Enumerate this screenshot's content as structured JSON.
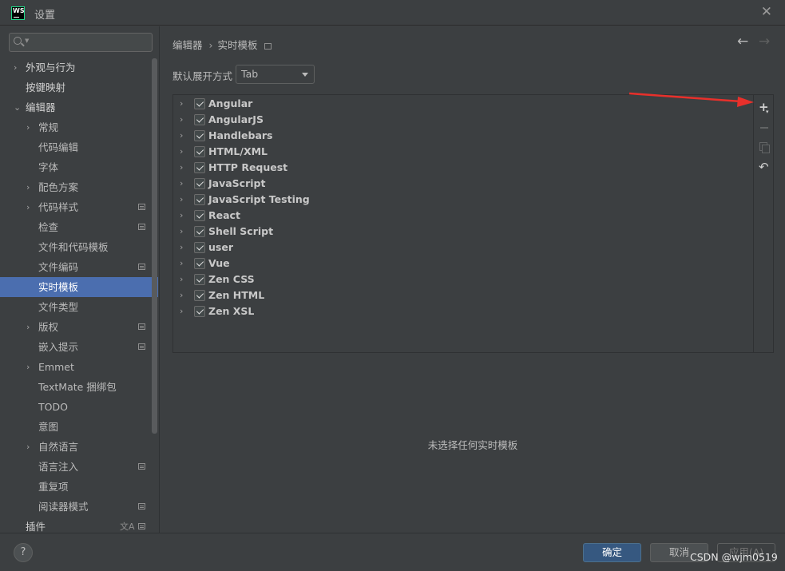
{
  "window": {
    "title": "设置",
    "logo_text": "WS"
  },
  "search": {
    "placeholder": ""
  },
  "sidebar": {
    "items": [
      {
        "label": "外观与行为",
        "level": 0,
        "expandable": true,
        "bold": true
      },
      {
        "label": "按键映射",
        "level": 0,
        "expandable": false,
        "bold": true
      },
      {
        "label": "编辑器",
        "level": 0,
        "expandable": true,
        "expanded": true,
        "bold": true
      },
      {
        "label": "常规",
        "level": 1,
        "expandable": true
      },
      {
        "label": "代码编辑",
        "level": 1
      },
      {
        "label": "字体",
        "level": 1
      },
      {
        "label": "配色方案",
        "level": 1,
        "expandable": true
      },
      {
        "label": "代码样式",
        "level": 1,
        "expandable": true,
        "project_icon": true
      },
      {
        "label": "检查",
        "level": 1,
        "project_icon": true
      },
      {
        "label": "文件和代码模板",
        "level": 1
      },
      {
        "label": "文件编码",
        "level": 1,
        "project_icon": true
      },
      {
        "label": "实时模板",
        "level": 1,
        "selected": true
      },
      {
        "label": "文件类型",
        "level": 1
      },
      {
        "label": "版权",
        "level": 1,
        "expandable": true,
        "project_icon": true
      },
      {
        "label": "嵌入提示",
        "level": 1,
        "project_icon": true
      },
      {
        "label": "Emmet",
        "level": 1,
        "expandable": true
      },
      {
        "label": "TextMate 捆绑包",
        "level": 1
      },
      {
        "label": "TODO",
        "level": 1
      },
      {
        "label": "意图",
        "level": 1
      },
      {
        "label": "自然语言",
        "level": 1,
        "expandable": true
      },
      {
        "label": "语言注入",
        "level": 1,
        "project_icon": true
      },
      {
        "label": "重复项",
        "level": 1
      },
      {
        "label": "阅读器模式",
        "level": 1,
        "project_icon": true
      },
      {
        "label": "插件",
        "level": 0,
        "bold": true,
        "project_icon": true,
        "translate_icon": true
      }
    ]
  },
  "breadcrumb": {
    "parent": "编辑器",
    "current": "实时模板"
  },
  "expand": {
    "label": "默认展开方式",
    "value": "Tab"
  },
  "templates": [
    {
      "name": "Angular",
      "checked": true
    },
    {
      "name": "AngularJS",
      "checked": true
    },
    {
      "name": "Handlebars",
      "checked": true
    },
    {
      "name": "HTML/XML",
      "checked": true
    },
    {
      "name": "HTTP Request",
      "checked": true
    },
    {
      "name": "JavaScript",
      "checked": true
    },
    {
      "name": "JavaScript Testing",
      "checked": true
    },
    {
      "name": "React",
      "checked": true
    },
    {
      "name": "Shell Script",
      "checked": true
    },
    {
      "name": "user",
      "checked": true
    },
    {
      "name": "Vue",
      "checked": true
    },
    {
      "name": "Zen CSS",
      "checked": true
    },
    {
      "name": "Zen HTML",
      "checked": true
    },
    {
      "name": "Zen XSL",
      "checked": true
    }
  ],
  "empty_message": "未选择任何实时模板",
  "footer": {
    "help": "?",
    "ok": "确定",
    "cancel": "取消",
    "apply": "应用(A)",
    "watermark": "CSDN @wjm0519"
  },
  "colors": {
    "background": "#3c3f41",
    "selection": "#4b6eaf",
    "primary_button": "#365880",
    "annotation_arrow": "#e8302b"
  }
}
